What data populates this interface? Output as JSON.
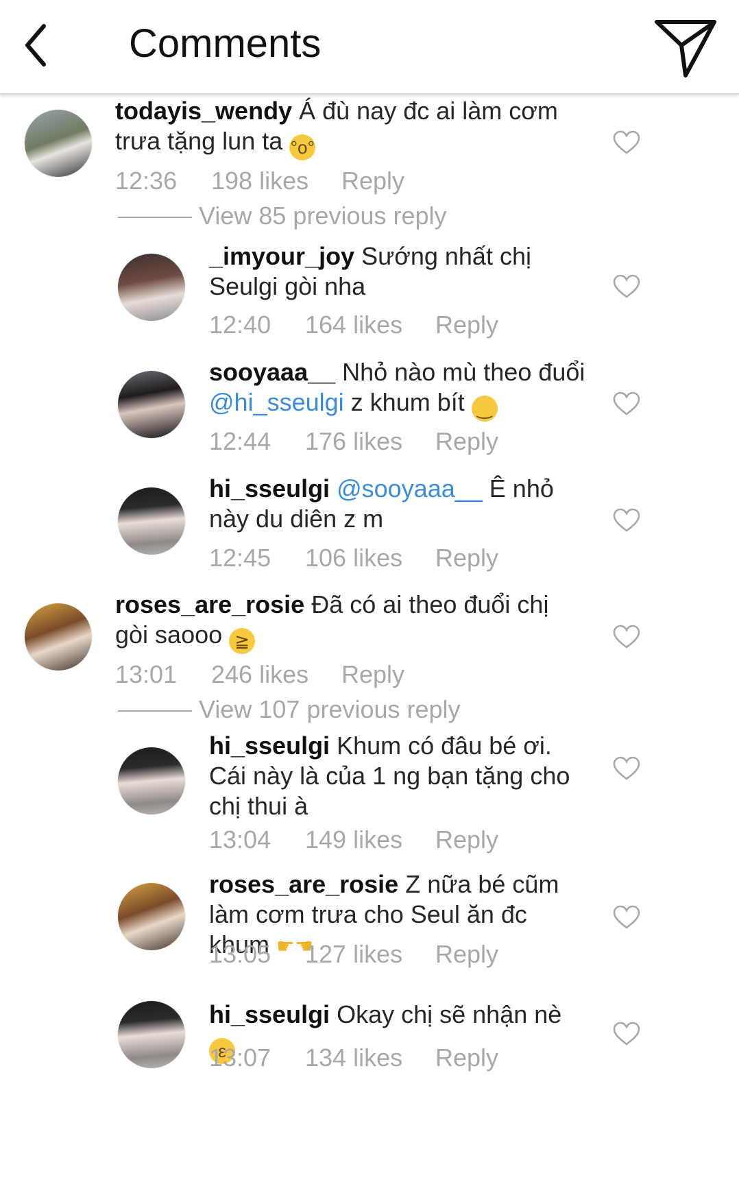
{
  "header": {
    "title": "Comments"
  },
  "view_previous": [
    "View 85 previous reply",
    "View 107 previous reply"
  ],
  "comments": [
    {
      "username": "todayis_wendy",
      "text": "Á đù nay đc ai làm cơm trưa tặng lun ta",
      "emoji": "astonished-face",
      "time": "12:36",
      "likes": "198 likes",
      "reply": "Reply"
    },
    {
      "username": "_imyour_joy",
      "text": "Sướng nhất chị Seulgi gòi nha",
      "time": "12:40",
      "likes": "164 likes",
      "reply": "Reply"
    },
    {
      "username": "sooyaaa__",
      "text": "Nhỏ nào mù theo đuổi",
      "mention": "@hi_sseulgi",
      "text_after": "z khum bít",
      "emoji": "smirking-face",
      "time": "12:44",
      "likes": "176 likes",
      "reply": "Reply"
    },
    {
      "username": "hi_sseulgi",
      "mention": "@sooyaaa__",
      "text": "Ê nhỏ này du diên z m",
      "time": "12:45",
      "likes": "106 likes",
      "reply": "Reply"
    },
    {
      "username": "roses_are_rosie",
      "text": "Đã có ai theo đuổi chị gòi saooo",
      "emoji": "loudly-crying-face",
      "time": "13:01",
      "likes": "246 likes",
      "reply": "Reply"
    },
    {
      "username": "hi_sseulgi",
      "text": "Khum có đâu bé ơi. Cái này là của 1 ng bạn tặng cho chị thui à",
      "time": "13:04",
      "likes": "149 likes",
      "reply": "Reply"
    },
    {
      "username": "roses_are_rosie",
      "text": "Z nữa bé cũm làm cơm trưa cho Seul ăn đc khum",
      "emoji": "pointing-hands",
      "time": "13:05",
      "likes": "127 likes",
      "reply": "Reply"
    },
    {
      "username": "hi_sseulgi",
      "text": "Okay chị sẽ nhận nè",
      "emoji": "kissing-face",
      "time": "13:07",
      "likes": "134 likes",
      "reply": "Reply"
    }
  ],
  "colors": {
    "mention": "#3b8bd9",
    "meta": "#a8a8a8",
    "text": "#262626"
  }
}
